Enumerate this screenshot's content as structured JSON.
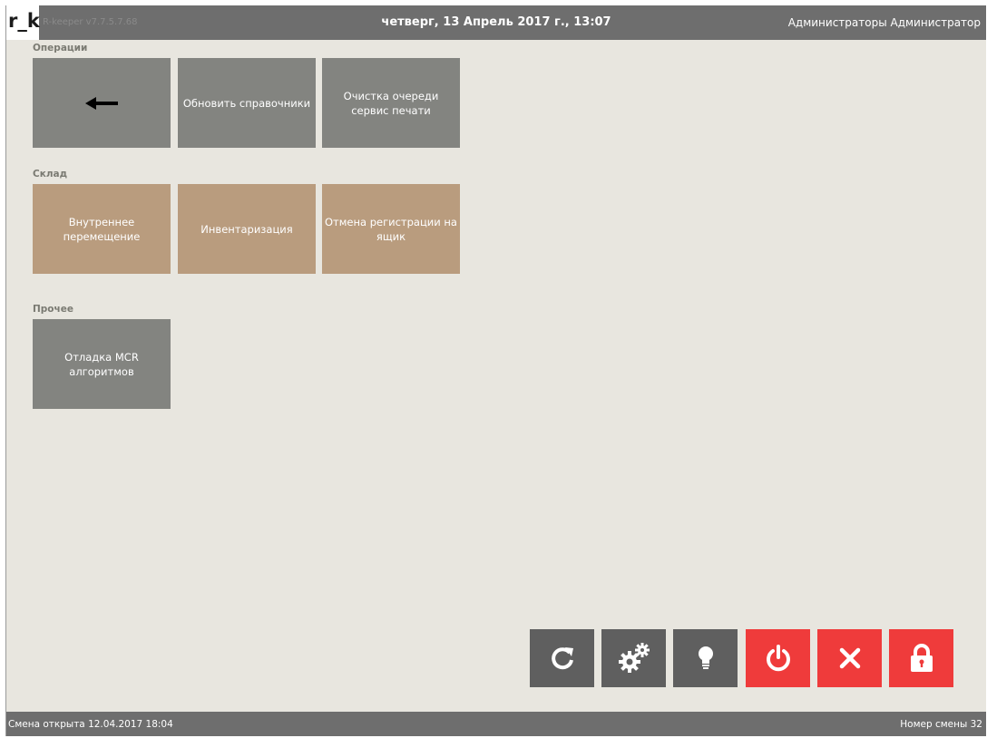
{
  "header": {
    "logo": "r_k",
    "version": "R-keeper v7.7.5.7.68",
    "datetime": "четверг, 13 Апрель 2017 г., 13:07",
    "user": "Администраторы Администратор"
  },
  "sections": {
    "operations": {
      "title": "Операции",
      "tiles": [
        "",
        "Обновить справочники",
        "Очистка очереди сервис печати"
      ]
    },
    "warehouse": {
      "title": "Склад",
      "tiles": [
        "Внутреннее перемещение",
        "Инвентаризация",
        "Отмена регистрации на ящик"
      ]
    },
    "other": {
      "title": "Прочее",
      "tiles": [
        "Отладка MCR алгоритмов"
      ]
    }
  },
  "toolbar": {
    "buttons": [
      {
        "icon": "refresh-icon"
      },
      {
        "icon": "gears-icon"
      },
      {
        "icon": "lightbulb-icon"
      },
      {
        "icon": "power-icon"
      },
      {
        "icon": "close-icon"
      },
      {
        "icon": "lock-icon"
      }
    ]
  },
  "status": {
    "shift_opened": "Смена открыта 12.04.2017 18:04",
    "shift_number": "Номер смены 32"
  },
  "colors": {
    "titlebar": "#6e6e6e",
    "background": "#e8e6df",
    "tile_gray": "#838480",
    "tile_tan": "#b99c7e",
    "toolbar_dark": "#5f5f5f",
    "toolbar_red": "#ef3b3b"
  }
}
